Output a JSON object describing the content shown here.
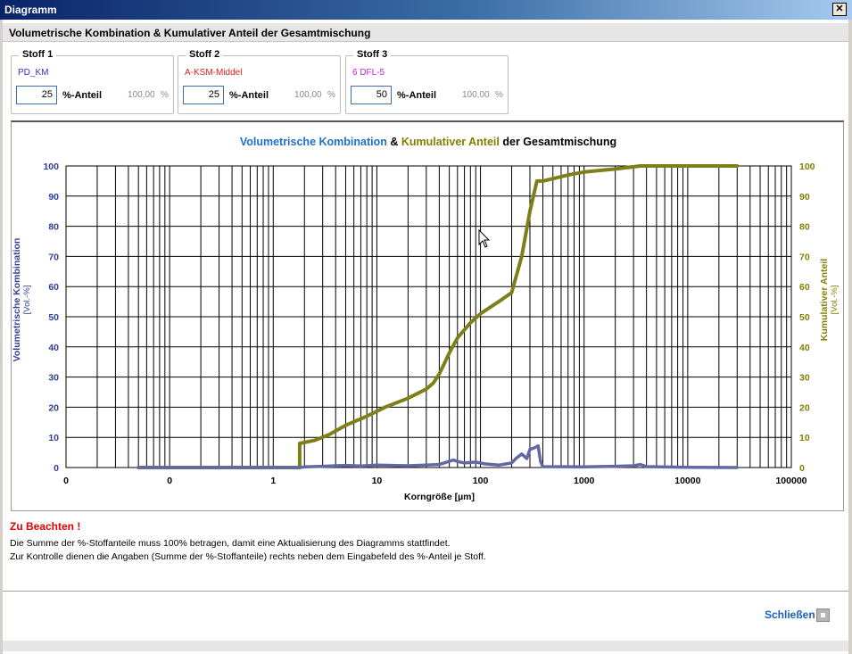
{
  "window": {
    "title": "Diagramm",
    "close_glyph": "✕"
  },
  "header": {
    "title": "Volumetrische Kombination & Kumulativer Anteil der Gesamtmischung"
  },
  "stoffe": [
    {
      "legend": "Stoff 1",
      "name": "PD_KM",
      "name_color": "#3333cc",
      "value": "25",
      "label": "%-Anteil",
      "sum": "100,00",
      "pct": "%"
    },
    {
      "legend": "Stoff 2",
      "name": "A-KSM-Middel",
      "name_color": "#e02020",
      "value": "25",
      "label": "%-Anteil",
      "sum": "100,00",
      "pct": "%"
    },
    {
      "legend": "Stoff 3",
      "name": "6 DFL-5",
      "name_color": "#cc22cc",
      "value": "50",
      "label": "%-Anteil",
      "sum": "100,00",
      "pct": "%"
    }
  ],
  "chart": {
    "title_part1": "Volumetrische Kombination",
    "title_part2": "&",
    "title_part3": "Kumulativer Anteil",
    "title_part4": "der Gesamtmischung",
    "ylabel_left_1": "Volumetrische Kombination",
    "ylabel_left_2": "[Vol.-%]",
    "ylabel_right_1": "Kumulativer Anteil",
    "ylabel_right_2": "[Vol.-%]",
    "xlabel": "Korngröße [µm]",
    "colors": {
      "left": "#2f3f99",
      "right": "#808000",
      "vol": "#6268a4",
      "cum": "#7f7f1a",
      "title_blue": "#1f6fcc"
    }
  },
  "chart_data": {
    "type": "line",
    "x_scale": "log",
    "xlim": [
      0.01,
      100000
    ],
    "x_tick_labels": [
      "0",
      "0",
      "1",
      "10",
      "100",
      "1000",
      "10000",
      "100000"
    ],
    "y_left_ticks": [
      0,
      10,
      20,
      30,
      40,
      50,
      60,
      70,
      80,
      90,
      100
    ],
    "y_right_ticks": [
      0,
      10,
      20,
      30,
      40,
      50,
      60,
      70,
      80,
      90,
      100
    ],
    "ylim": [
      0,
      100
    ],
    "grid": true,
    "series": [
      {
        "axis": "right",
        "x": [
          0.05,
          0.5,
          1.6,
          1.8,
          1.8,
          2.5,
          3.5,
          5,
          8,
          12,
          20,
          30,
          35,
          40,
          50,
          60,
          80,
          100,
          150,
          200,
          250,
          300,
          350,
          400,
          700,
          1000,
          2000,
          3500,
          5000,
          10000,
          30000
        ],
        "values": [
          0,
          0,
          0,
          0,
          8,
          9,
          11,
          14,
          17,
          20,
          23,
          26,
          28,
          31,
          38,
          43,
          48,
          51,
          55,
          58,
          70,
          85,
          95,
          95,
          97,
          98,
          99,
          100,
          100,
          100,
          100
        ]
      },
      {
        "axis": "left",
        "x": [
          0.05,
          1.8,
          2,
          3,
          5,
          7,
          10,
          20,
          40,
          55,
          60,
          70,
          90,
          110,
          150,
          200,
          220,
          250,
          280,
          300,
          330,
          360,
          380,
          400,
          1000,
          2000,
          3000,
          3500,
          4000,
          10000,
          30000
        ],
        "values": [
          0,
          0,
          0.2,
          0.4,
          0.7,
          0.5,
          0.8,
          0.6,
          1,
          2.5,
          2,
          1.5,
          1.8,
          1.2,
          0.8,
          1.5,
          3,
          4.5,
          3,
          6,
          6.5,
          7.2,
          2,
          0.3,
          0.2,
          0.4,
          0.6,
          1,
          0.3,
          0.1,
          0
        ]
      }
    ]
  },
  "notes": {
    "title": "Zu Beachten !",
    "line1": "Die Summe der %-Stoffanteile muss 100% betragen, damit eine Aktualisierung des Diagramms stattfindet.",
    "line2": "Zur Kontrolle dienen die Angaben (Summe der %-Stoffanteile) rechts neben dem Eingabefeld des %-Anteil je Stoff."
  },
  "footer": {
    "close_label": "Schließen"
  }
}
